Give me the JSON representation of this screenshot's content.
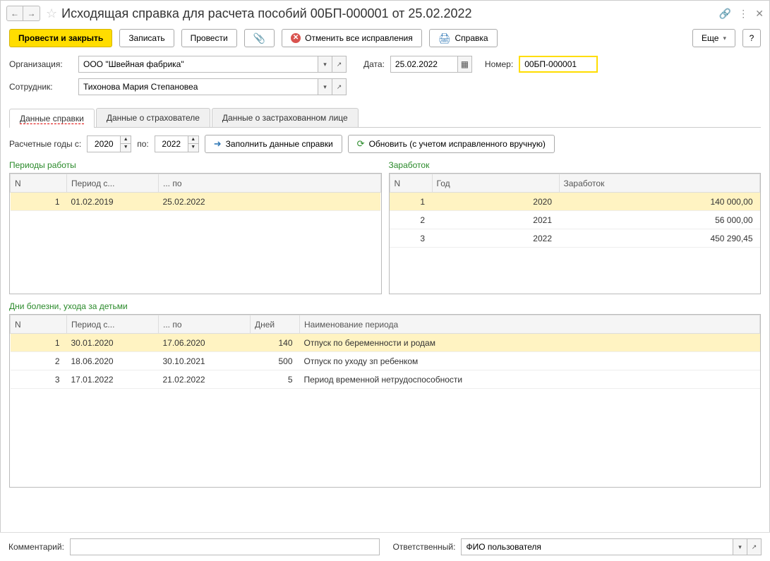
{
  "title": "Исходящая справка для расчета пособий 00БП-000001 от 25.02.2022",
  "toolbar": {
    "post_close": "Провести и закрыть",
    "save": "Записать",
    "post": "Провести",
    "cancel_corrections": "Отменить все исправления",
    "report": "Справка",
    "more": "Еще",
    "help": "?"
  },
  "fields": {
    "org_label": "Организация:",
    "org_value": "ООО \"Швейная фабрика\"",
    "date_label": "Дата:",
    "date_value": "25.02.2022",
    "number_label": "Номер:",
    "number_value": "00БП-000001",
    "employee_label": "Сотрудник:",
    "employee_value": "Тихонова Мария Степановеа",
    "comment_label": "Комментарий:",
    "comment_value": "",
    "responsible_label": "Ответственный:",
    "responsible_value": "ФИО пользователя"
  },
  "tabs": {
    "t1": "Данные справки",
    "t2": "Данные о страхователе",
    "t3": "Данные о застрахованном лице"
  },
  "years": {
    "label_from": "Расчетные годы с:",
    "from": "2020",
    "label_to": "по:",
    "to": "2022",
    "fill_btn": "Заполнить данные справки",
    "refresh_btn": "Обновить (с учетом исправленного вручную)"
  },
  "periods": {
    "title": "Периоды работы",
    "h_n": "N",
    "h_from": "Период с...",
    "h_to": "... по",
    "rows": [
      {
        "n": "1",
        "from": "01.02.2019",
        "to": "25.02.2022"
      }
    ]
  },
  "earnings": {
    "title": "Заработок",
    "h_n": "N",
    "h_year": "Год",
    "h_sum": "Заработок",
    "rows": [
      {
        "n": "1",
        "year": "2020",
        "sum": "140 000,00"
      },
      {
        "n": "2",
        "year": "2021",
        "sum": "56 000,00"
      },
      {
        "n": "3",
        "year": "2022",
        "sum": "450 290,45"
      }
    ]
  },
  "sick": {
    "title": "Дни болезни, ухода за детьми",
    "h_n": "N",
    "h_from": "Период с...",
    "h_to": "... по",
    "h_days": "Дней",
    "h_name": "Наименование периода",
    "rows": [
      {
        "n": "1",
        "from": "30.01.2020",
        "to": "17.06.2020",
        "days": "140",
        "name": "Отпуск по беременности и родам"
      },
      {
        "n": "2",
        "from": "18.06.2020",
        "to": "30.10.2021",
        "days": "500",
        "name": "Отпуск по уходу зп ребенком"
      },
      {
        "n": "3",
        "from": "17.01.2022",
        "to": "21.02.2022",
        "days": "5",
        "name": "Период временной нетрудоспособности"
      }
    ]
  }
}
